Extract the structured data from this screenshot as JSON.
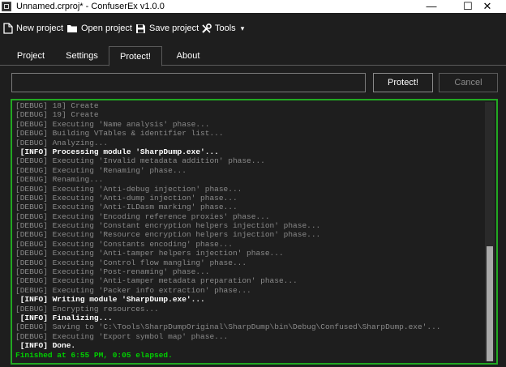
{
  "window": {
    "title": "Unnamed.crproj* - ConfuserEx v1.0.0",
    "minimize_glyph": "—",
    "maximize_glyph": "☐",
    "close_glyph": "✕"
  },
  "toolbar": {
    "new_project": "New project",
    "open_project": "Open project",
    "save_project": "Save project",
    "tools": "Tools",
    "tools_caret": "▾",
    "icons": [
      "new-file-icon",
      "folder-icon",
      "save-icon",
      "tools-icon"
    ]
  },
  "tabs": [
    "Project",
    "Settings",
    "Protect!",
    "About"
  ],
  "active_tab": "Protect!",
  "protect_panel": {
    "path_value": "",
    "protect_button": "Protect!",
    "cancel_button": "Cancel"
  },
  "colors": {
    "background": "#1e1e1e",
    "log_border": "#22a822",
    "debug_text": "#8a8a8a",
    "info_text": "#ffffff",
    "finish_text": "#00d000",
    "cancel_disabled_text": "#8a8a8a"
  },
  "log": {
    "lines": [
      {
        "level": "debug",
        "text": "[DEBUG] 18] Create"
      },
      {
        "level": "debug",
        "text": "[DEBUG] 19] Create"
      },
      {
        "level": "debug",
        "text": "[DEBUG] Executing 'Name analysis' phase..."
      },
      {
        "level": "debug",
        "text": "[DEBUG] Building VTables & identifier list..."
      },
      {
        "level": "debug",
        "text": "[DEBUG] Analyzing..."
      },
      {
        "level": "info",
        "text": " [INFO] Processing module 'SharpDump.exe'..."
      },
      {
        "level": "debug",
        "text": "[DEBUG] Executing 'Invalid metadata addition' phase..."
      },
      {
        "level": "debug",
        "text": "[DEBUG] Executing 'Renaming' phase..."
      },
      {
        "level": "debug",
        "text": "[DEBUG] Renaming..."
      },
      {
        "level": "debug",
        "text": "[DEBUG] Executing 'Anti-debug injection' phase..."
      },
      {
        "level": "debug",
        "text": "[DEBUG] Executing 'Anti-dump injection' phase..."
      },
      {
        "level": "debug",
        "text": "[DEBUG] Executing 'Anti-ILDasm marking' phase..."
      },
      {
        "level": "debug",
        "text": "[DEBUG] Executing 'Encoding reference proxies' phase..."
      },
      {
        "level": "debug",
        "text": "[DEBUG] Executing 'Constant encryption helpers injection' phase..."
      },
      {
        "level": "debug",
        "text": "[DEBUG] Executing 'Resource encryption helpers injection' phase..."
      },
      {
        "level": "debug",
        "text": "[DEBUG] Executing 'Constants encoding' phase..."
      },
      {
        "level": "debug",
        "text": "[DEBUG] Executing 'Anti-tamper helpers injection' phase..."
      },
      {
        "level": "debug",
        "text": "[DEBUG] Executing 'Control flow mangling' phase..."
      },
      {
        "level": "debug",
        "text": "[DEBUG] Executing 'Post-renaming' phase..."
      },
      {
        "level": "debug",
        "text": "[DEBUG] Executing 'Anti-tamper metadata preparation' phase..."
      },
      {
        "level": "debug",
        "text": "[DEBUG] Executing 'Packer info extraction' phase..."
      },
      {
        "level": "info",
        "text": " [INFO] Writing module 'SharpDump.exe'..."
      },
      {
        "level": "debug",
        "text": "[DEBUG] Encrypting resources..."
      },
      {
        "level": "info",
        "text": " [INFO] Finalizing..."
      },
      {
        "level": "debug",
        "text": "[DEBUG] Saving to 'C:\\Tools\\SharpDumpOriginal\\SharpDump\\bin\\Debug\\Confused\\SharpDump.exe'..."
      },
      {
        "level": "debug",
        "text": "[DEBUG] Executing 'Export symbol map' phase..."
      },
      {
        "level": "info",
        "text": " [INFO] Done."
      },
      {
        "level": "finish",
        "text": "Finished at 6:55 PM, 0:05 elapsed."
      }
    ]
  }
}
